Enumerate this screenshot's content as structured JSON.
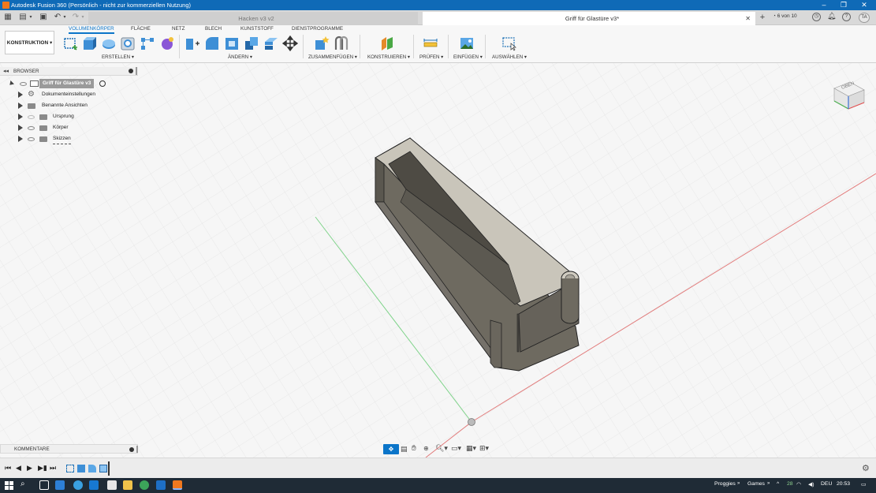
{
  "window": {
    "title": "Autodesk Fusion 360 (Persönlich - nicht zur kommerziellen Nutzung)"
  },
  "tabs": [
    {
      "label": "Hacken v3 v2",
      "active": false
    },
    {
      "label": "Griff für Glastüre v3*",
      "active": true
    }
  ],
  "jobs": "6 von 10",
  "user_initials": "TA",
  "workspace": "KONSTRUKTION",
  "ribbon_tabs": [
    "VOLUMENKÖRPER",
    "FLÄCHE",
    "NETZ",
    "BLECH",
    "KUNSTSTOFF",
    "DIENSTPROGRAMME"
  ],
  "ribbon_groups": [
    "ERSTELLEN ▾",
    "ÄNDERN ▾",
    "ZUSAMMENFÜGEN ▾",
    "KONSTRUIEREN ▾",
    "PRÜFEN ▾",
    "EINFÜGEN ▾",
    "AUSWÄHLEN ▾"
  ],
  "browser": {
    "title": "BROWSER",
    "root": "Griff für Glastüre v3",
    "items": [
      "Dokumenteinstellungen",
      "Benannte Ansichten",
      "Ursprung",
      "Körper",
      "Skizzen"
    ]
  },
  "viewcube_label": "OBEN",
  "comments_label": "KOMMENTARE",
  "taskbar": {
    "tray_items": [
      "Proggies",
      "Games"
    ],
    "temperature": "28",
    "language": "DEU",
    "time": "20:53"
  },
  "colors": {
    "titlebar": "#0f6ab7",
    "accent": "#0b75c9",
    "taskbar": "#1f2b36",
    "model": "#6e6a60"
  }
}
